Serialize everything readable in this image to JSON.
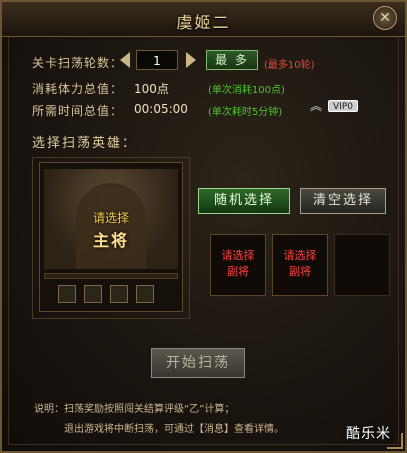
{
  "window": {
    "title": "虞姬二",
    "close_icon": "close-icon"
  },
  "sweep": {
    "rounds_label": "关卡扫荡轮数：",
    "rounds_value": "1",
    "most_button": "最 多",
    "rounds_note": "(最多10轮)",
    "stamina_label": "消耗体力总值：",
    "stamina_value": "100点",
    "stamina_note": "(单次消耗100点)",
    "time_label": "所需时间总值：",
    "time_value": "00:05:00",
    "time_note": "(单次耗时5分钟)",
    "vip_badge": "VIP0"
  },
  "hero_select": {
    "title": "选择扫荡英雄：",
    "main_tag_top": "请选择",
    "main_tag_bottom": "主将",
    "random_button": "随机选择",
    "clear_button": "清空选择",
    "deputies": [
      {
        "line1": "请选择",
        "line2": "副将"
      },
      {
        "line1": "请选择",
        "line2": "副将"
      },
      {
        "line1": "",
        "line2": ""
      }
    ]
  },
  "start_button": "开始扫荡",
  "description": {
    "line1": "说明：扫荡奖励按照闯关结算评级“乙”计算；",
    "line2": "退出游戏将中断扫荡，可通过【消息】查看详情。"
  },
  "watermark": "酷乐米",
  "colors": {
    "frame": "#6d5632",
    "green_note": "#4fc22c",
    "deputy_text": "#ff4141",
    "rounds_note": "#e04a3a"
  }
}
